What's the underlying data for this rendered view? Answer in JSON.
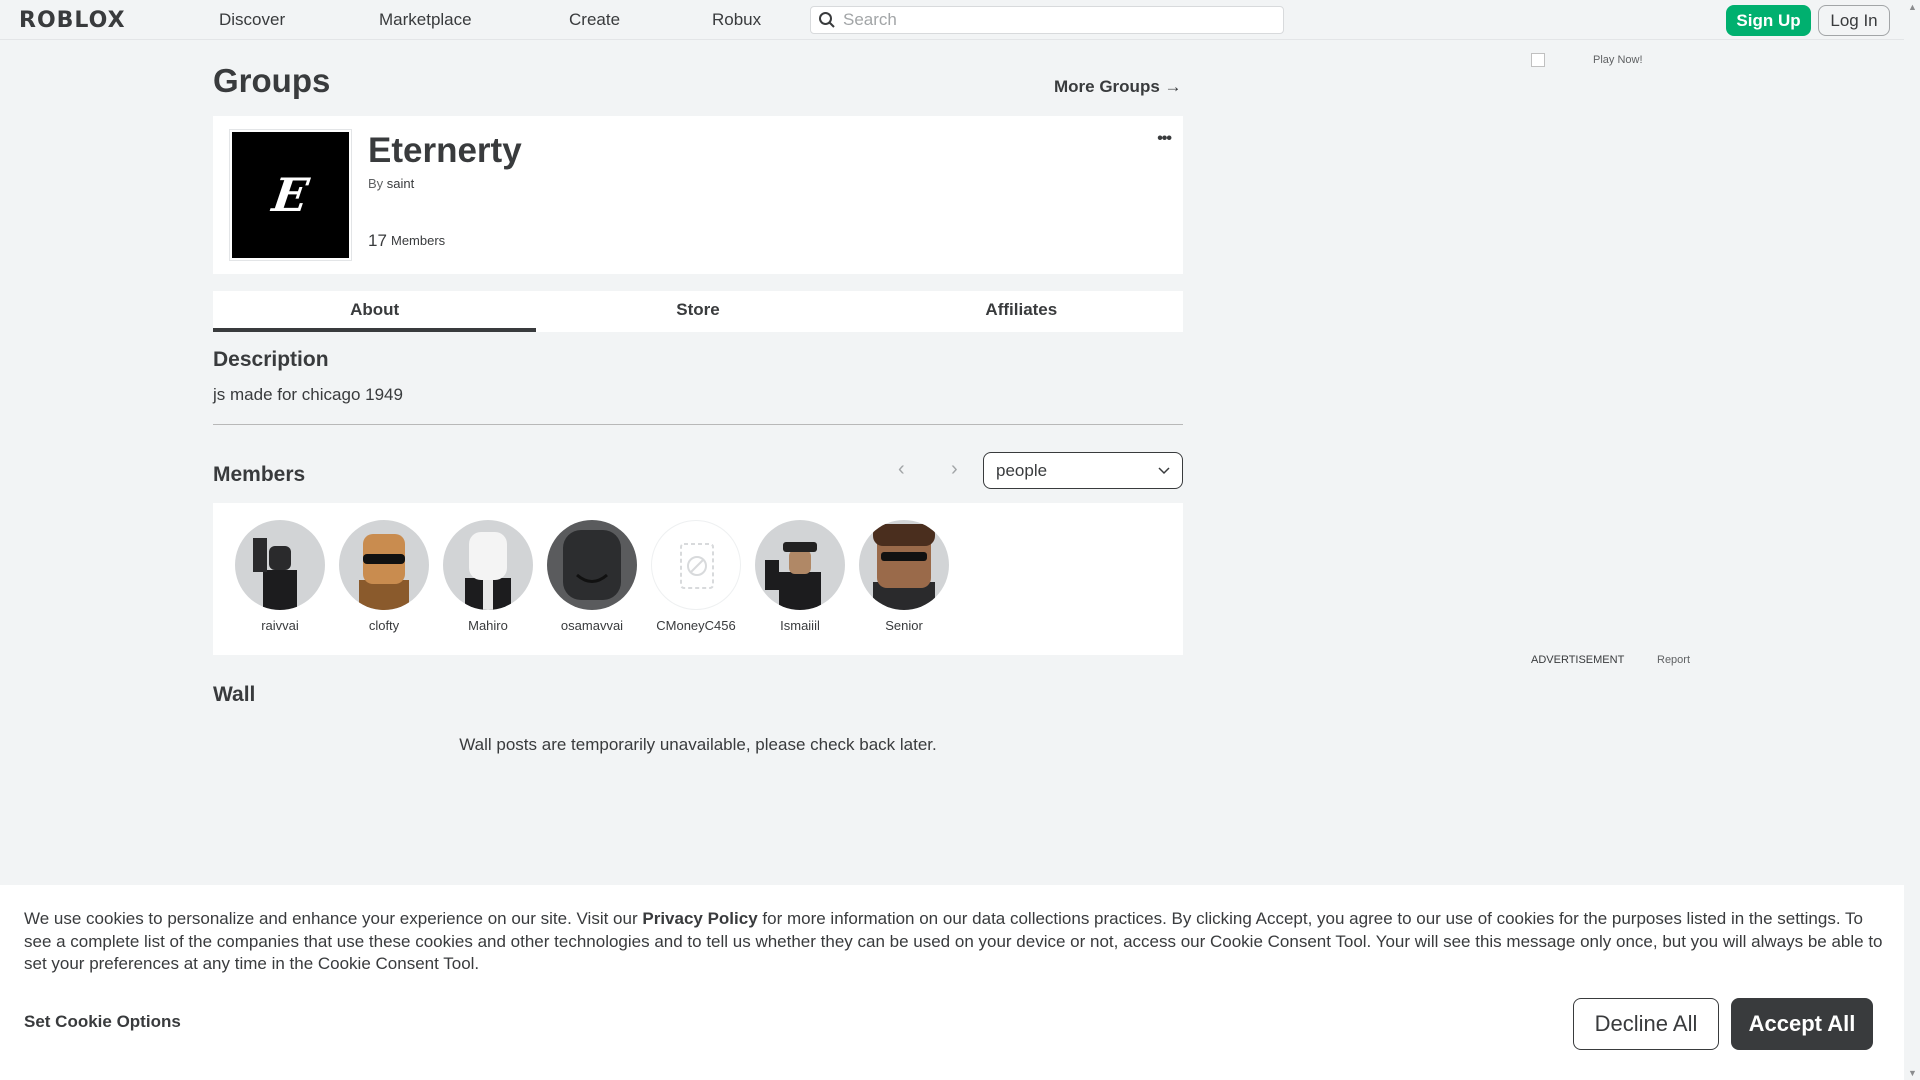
{
  "header": {
    "logo": "ROBLOX",
    "nav": [
      "Discover",
      "Marketplace",
      "Create",
      "Robux"
    ],
    "search_placeholder": "Search",
    "signup_label": "Sign Up",
    "login_label": "Log In"
  },
  "page": {
    "title": "Groups",
    "more_groups": "More Groups →"
  },
  "group": {
    "name": "Eternerty",
    "by_label": "By",
    "owner": "saint",
    "member_count": "17",
    "members_label": "Members",
    "thumb_letter": "E"
  },
  "tabs": [
    "About",
    "Store",
    "Affiliates"
  ],
  "description": {
    "title": "Description",
    "text": "js made for chicago 1949"
  },
  "members": {
    "title": "Members",
    "role_selected": "people",
    "list": [
      {
        "name": "raivvai",
        "color": "#c9cbcd"
      },
      {
        "name": "clofty",
        "color": "#c9cbcd"
      },
      {
        "name": "Mahiro",
        "color": "#c9cbcd"
      },
      {
        "name": "osamavvai",
        "color": "#c9cbcd"
      },
      {
        "name": "CMoneyC456",
        "color": "#ffffff"
      },
      {
        "name": "Ismaiiil",
        "color": "#c9cbcd"
      },
      {
        "name": "Senior",
        "color": "#c9cbcd"
      }
    ]
  },
  "wall": {
    "title": "Wall",
    "message": "Wall posts are temporarily unavailable, please check back later."
  },
  "ad": {
    "alt": "Play Now!",
    "label": "ADVERTISEMENT",
    "report": "Report"
  },
  "cookie": {
    "text_before": "We use cookies to personalize and enhance your experience on our site. Visit our ",
    "policy_link": "Privacy Policy",
    "text_after": " for more information on our data collections practices. By clicking Accept, you agree to our use of cookies for the purposes listed in the settings. To see a complete list of the companies that use these cookies and other technologies and to tell us whether they can be used on your device or not, access our Cookie Consent Tool. Your will see this message only once, but you will always be able to set your preferences at any time in the Cookie Consent Tool.",
    "options_label": "Set Cookie Options",
    "decline_label": "Decline All",
    "accept_label": "Accept All"
  },
  "colors": {
    "accent_green": "#00b06f",
    "text_dark": "#393b3d",
    "page_bg": "#f2f4f5"
  }
}
